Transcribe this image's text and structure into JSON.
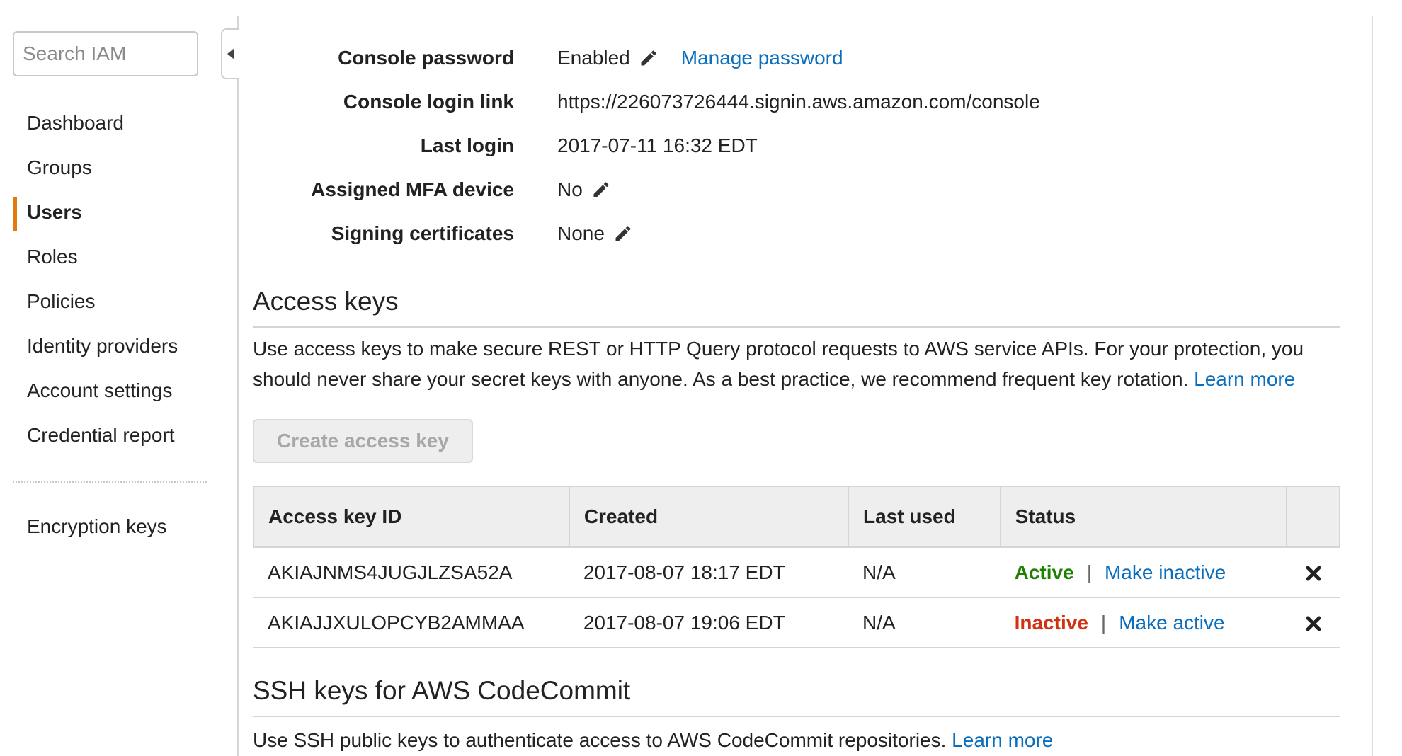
{
  "sidebar": {
    "search_placeholder": "Search IAM",
    "items": [
      {
        "label": "Dashboard"
      },
      {
        "label": "Groups"
      },
      {
        "label": "Users"
      },
      {
        "label": "Roles"
      },
      {
        "label": "Policies"
      },
      {
        "label": "Identity providers"
      },
      {
        "label": "Account settings"
      },
      {
        "label": "Credential report"
      }
    ],
    "active_item": "Users",
    "extra_item": "Encryption keys"
  },
  "summary": {
    "console_password": {
      "label": "Console password",
      "value": "Enabled",
      "link": "Manage password",
      "icon": "pencil-icon"
    },
    "console_login_link": {
      "label": "Console login link",
      "value": "https://226073726444.signin.aws.amazon.com/console"
    },
    "last_login": {
      "label": "Last login",
      "value": "2017-07-11 16:32 EDT"
    },
    "mfa_device": {
      "label": "Assigned MFA device",
      "value": "No",
      "icon": "pencil-icon"
    },
    "signing_certificates": {
      "label": "Signing certificates",
      "value": "None",
      "icon": "pencil-icon"
    }
  },
  "access_keys": {
    "title": "Access keys",
    "description": "Use access keys to make secure REST or HTTP Query protocol requests to AWS service APIs. For your protection, you should never share your secret keys with anyone. As a best practice, we recommend frequent key rotation.",
    "learn_more": "Learn more",
    "create_button": "Create access key",
    "create_button_disabled": true,
    "columns": [
      "Access key ID",
      "Created",
      "Last used",
      "Status"
    ],
    "rows": [
      {
        "id": "AKIAJNMS4JUGJLZSA52A",
        "created": "2017-08-07 18:17 EDT",
        "last_used": "N/A",
        "status": "Active",
        "action": "Make inactive"
      },
      {
        "id": "AKIAJJXULOPCYB2AMMAA",
        "created": "2017-08-07 19:06 EDT",
        "last_used": "N/A",
        "status": "Inactive",
        "action": "Make active"
      }
    ],
    "separator": "|",
    "delete_icon": "close-icon"
  },
  "ssh_keys": {
    "title": "SSH keys for AWS CodeCommit",
    "description": "Use SSH public keys to authenticate access to AWS CodeCommit repositories.",
    "learn_more": "Learn more"
  },
  "colors": {
    "accent": "#e47911",
    "link": "#0a6ebd",
    "active": "#1d8102",
    "inactive": "#d13212"
  }
}
